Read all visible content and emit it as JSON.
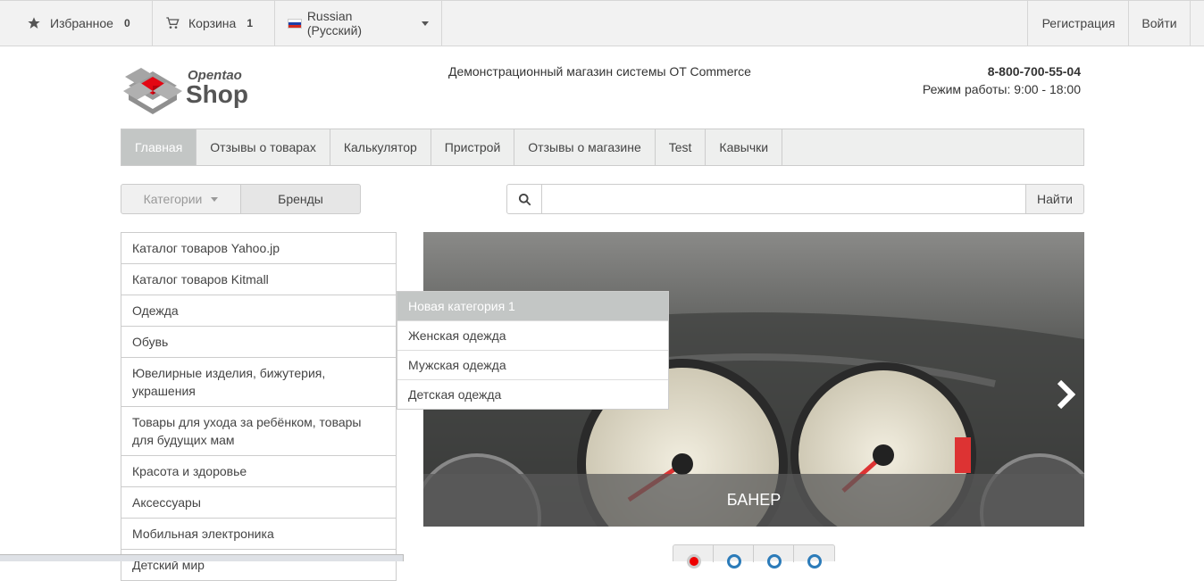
{
  "topbar": {
    "favorites": {
      "label": "Избранное",
      "count": "0"
    },
    "cart": {
      "label": "Корзина",
      "count": "1"
    },
    "language": {
      "label": "Russian (Русский)"
    },
    "register": "Регистрация",
    "login": "Войти"
  },
  "header": {
    "logo_top": "Opentao",
    "logo_bottom": "Shop",
    "tagline": "Демонстрационный магазин системы OT Commerce",
    "phone": "8-800-700-55-04",
    "hours": "Режим работы: 9:00 - 18:00"
  },
  "nav": {
    "items": [
      {
        "label": "Главная",
        "active": true
      },
      {
        "label": "Отзывы о товарах"
      },
      {
        "label": "Калькулятор"
      },
      {
        "label": "Пристрой"
      },
      {
        "label": "Отзывы о магазине"
      },
      {
        "label": "Test"
      },
      {
        "label": "Кавычки"
      }
    ]
  },
  "filters": {
    "categories": "Категории",
    "brands": "Бренды"
  },
  "search": {
    "placeholder": "",
    "button": "Найти"
  },
  "categories": [
    "Каталог товаров Yahoo.jp",
    "Каталог товаров Kitmall",
    "Одежда",
    "Обувь",
    "Ювелирные изделия, бижутерия, украшения",
    "Товары для ухода за ребёнком, товары для будущих мам",
    "Красота и здоровье",
    "Аксессуары",
    "Мобильная электроника",
    "Детский мир"
  ],
  "submenu": [
    "Новая категория 1",
    "Женская одежда",
    "Мужская одежда",
    "Детская одежда"
  ],
  "banner": {
    "caption": "БАНЕР"
  },
  "colors": {
    "nav_active": "#c3c6c5",
    "accent_red": "#e30613",
    "pager_blue": "#2b7bb9"
  }
}
